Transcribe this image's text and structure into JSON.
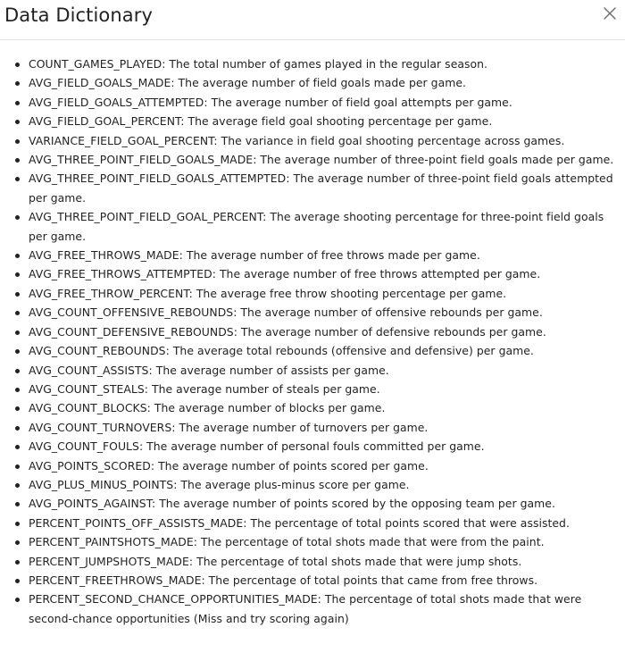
{
  "dialog": {
    "title": "Data Dictionary",
    "close_icon": "close-icon"
  },
  "items": [
    {
      "key": "COUNT_GAMES_PLAYED",
      "desc": "The total number of games played in the regular season."
    },
    {
      "key": "AVG_FIELD_GOALS_MADE",
      "desc": "The average number of field goals made per game."
    },
    {
      "key": "AVG_FIELD_GOALS_ATTEMPTED",
      "desc": "The average number of field goal attempts per game."
    },
    {
      "key": "AVG_FIELD_GOAL_PERCENT",
      "desc": "The average field goal shooting percentage per game."
    },
    {
      "key": "VARIANCE_FIELD_GOAL_PERCENT",
      "desc": "The variance in field goal shooting percentage across games."
    },
    {
      "key": "AVG_THREE_POINT_FIELD_GOALS_MADE",
      "desc": "The average number of three-point field goals made per game."
    },
    {
      "key": "AVG_THREE_POINT_FIELD_GOALS_ATTEMPTED",
      "desc": "The average number of three-point field goals attempted per game."
    },
    {
      "key": "AVG_THREE_POINT_FIELD_GOAL_PERCENT",
      "desc": "The average shooting percentage for three-point field goals per game."
    },
    {
      "key": "AVG_FREE_THROWS_MADE",
      "desc": "The average number of free throws made per game."
    },
    {
      "key": "AVG_FREE_THROWS_ATTEMPTED",
      "desc": "The average number of free throws attempted per game."
    },
    {
      "key": "AVG_FREE_THROW_PERCENT",
      "desc": "The average free throw shooting percentage per game."
    },
    {
      "key": "AVG_COUNT_OFFENSIVE_REBOUNDS",
      "desc": "The average number of offensive rebounds per game."
    },
    {
      "key": "AVG_COUNT_DEFENSIVE_REBOUNDS",
      "desc": "The average number of defensive rebounds per game."
    },
    {
      "key": "AVG_COUNT_REBOUNDS",
      "desc": "The average total rebounds (offensive and defensive) per game."
    },
    {
      "key": "AVG_COUNT_ASSISTS",
      "desc": "The average number of assists per game."
    },
    {
      "key": "AVG_COUNT_STEALS",
      "desc": "The average number of steals per game."
    },
    {
      "key": "AVG_COUNT_BLOCKS",
      "desc": "The average number of blocks per game."
    },
    {
      "key": "AVG_COUNT_TURNOVERS",
      "desc": "The average number of turnovers per game."
    },
    {
      "key": "AVG_COUNT_FOULS",
      "desc": "The average number of personal fouls committed per game."
    },
    {
      "key": "AVG_POINTS_SCORED",
      "desc": "The average number of points scored per game."
    },
    {
      "key": "AVG_PLUS_MINUS_POINTS",
      "desc": "The average plus-minus score per game."
    },
    {
      "key": "AVG_POINTS_AGAINST",
      "desc": "The average number of points scored by the opposing team per game."
    },
    {
      "key": "PERCENT_POINTS_OFF_ASSISTS_MADE",
      "desc": "The percentage of total points scored that were assisted."
    },
    {
      "key": "PERCENT_PAINTSHOTS_MADE",
      "desc": "The percentage of total shots made that were from the paint."
    },
    {
      "key": "PERCENT_JUMPSHOTS_MADE",
      "desc": "The percentage of total shots made that were jump shots."
    },
    {
      "key": "PERCENT_FREETHROWS_MADE",
      "desc": "The percentage of total points that came from free throws."
    },
    {
      "key": "PERCENT_SECOND_CHANCE_OPPORTUNITIES_MADE",
      "desc": "The percentage of total shots made that were second-chance opportunities (Miss and try scoring again)"
    }
  ]
}
